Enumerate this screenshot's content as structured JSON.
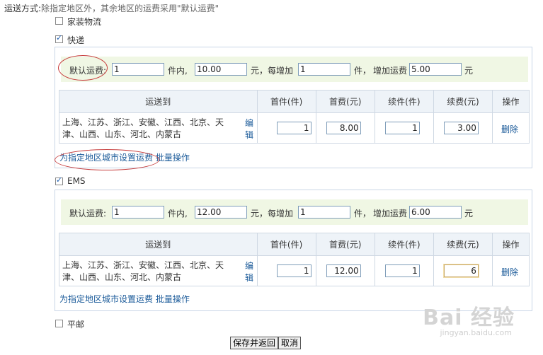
{
  "shipping_method": {
    "label": "运送方式:",
    "hint": "除指定地区外，其余地区的运费采用\"默认运费\""
  },
  "options": {
    "home_logistics": {
      "label": "家装物流",
      "checked": false
    },
    "express": {
      "label": "快递",
      "checked": true
    },
    "ems": {
      "label": "EMS",
      "checked": true
    },
    "surface_mail": {
      "label": "平邮",
      "checked": false
    }
  },
  "default_fee": {
    "label": "默认运费:",
    "unit_items_within": "件内,",
    "yuan_each_add": "元，每增加",
    "unit_items_add": "件，",
    "add_fee_label": "增加运费",
    "yuan": "元"
  },
  "express_default": {
    "first_qty": "1",
    "first_fee": "10.00",
    "add_qty": "1",
    "add_fee": "5.00"
  },
  "ems_default": {
    "first_qty": "1",
    "first_fee": "12.00",
    "add_qty": "1",
    "add_fee": "6.00"
  },
  "table_headers": {
    "destination": "运送到",
    "first_qty": "首件(件)",
    "first_fee": "首费(元)",
    "add_qty": "续件(件)",
    "add_fee": "续费(元)",
    "action": "操作"
  },
  "express_row": {
    "regions": "上海、江苏、浙江、安徽、江西、北京、天津、山西、山东、河北、内蒙古",
    "edit": "编辑",
    "first_qty": "1",
    "first_fee": "8.00",
    "add_qty": "1",
    "add_fee": "3.00",
    "delete": "删除"
  },
  "ems_row": {
    "regions": "上海、江苏、浙江、安徽、江西、北京、天津、山西、山东、河北、内蒙古",
    "edit": "编辑",
    "first_qty": "1",
    "first_fee": "12.00",
    "add_qty": "1",
    "add_fee": "6",
    "delete": "删除"
  },
  "links": {
    "set_region_fee": "为指定地区城市设置运费",
    "batch": "批量操作"
  },
  "buttons": {
    "save": "保存并返回",
    "cancel": "取消"
  },
  "watermark": {
    "main": "Bai 经验",
    "sub": "jingyan.baidu.com"
  },
  "colors": {
    "link": "#1a5a99",
    "annotation_oval": "#c63b3b",
    "default_row_bg": "#f0f7e4",
    "panel_border": "#c9d6e6"
  }
}
